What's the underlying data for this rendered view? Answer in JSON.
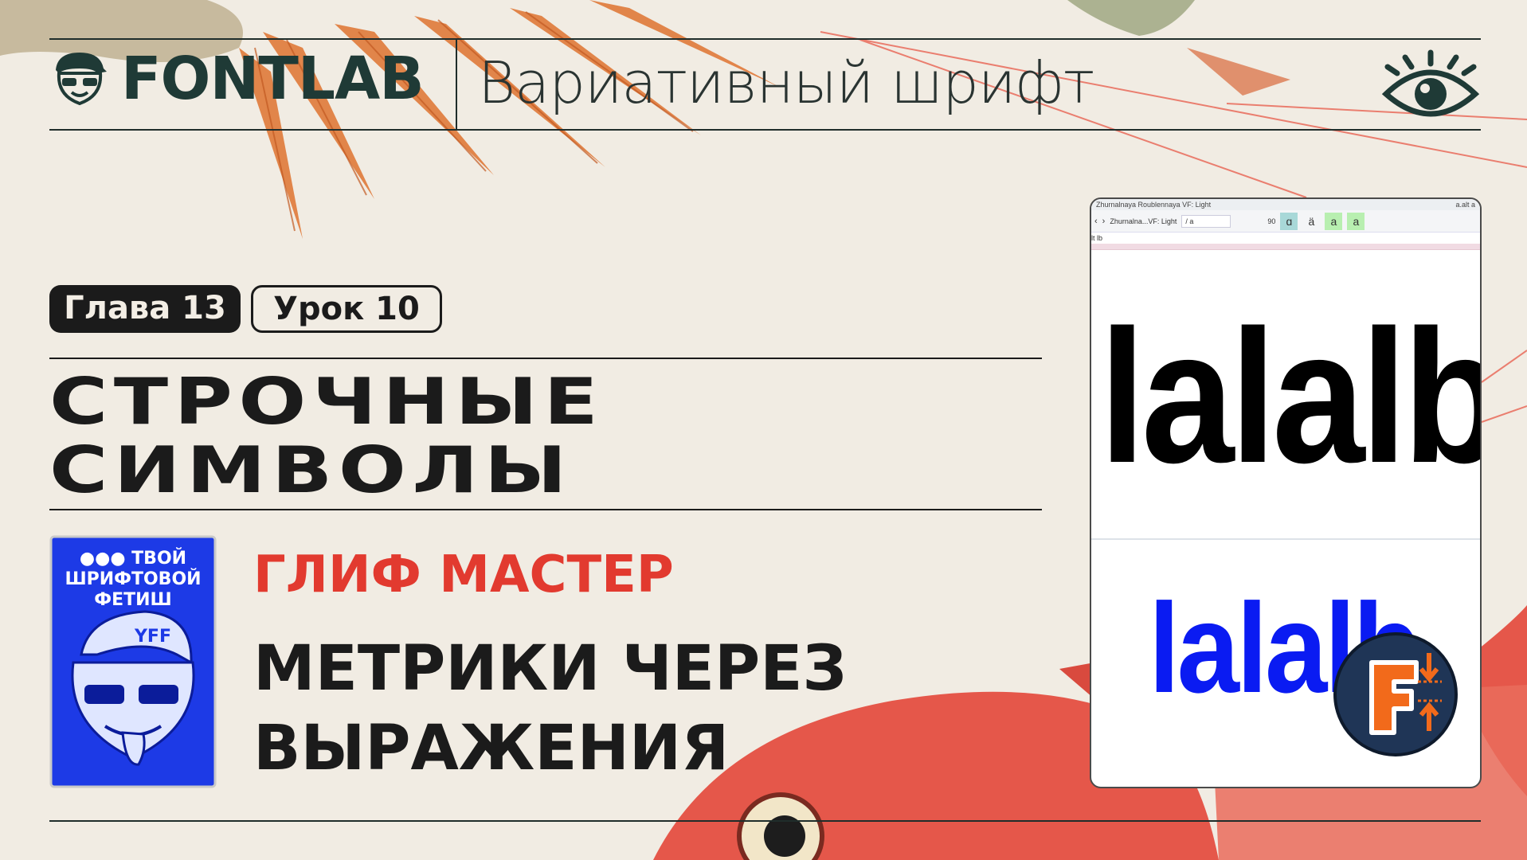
{
  "header": {
    "brand": "FONTLAB",
    "series_title": "Вариативный шрифт"
  },
  "badges": {
    "chapter": "Глава 13",
    "lesson": "Урок 10"
  },
  "section": {
    "line1": "СТРОЧНЫЕ",
    "line2": "СИМВОЛЫ"
  },
  "sticker": {
    "line1": "●●● ТВОЙ",
    "line2": "ШРИФТОВОЙ",
    "line3": "ФЕТИШ",
    "cap_text": "YFF"
  },
  "course": {
    "name": "ГЛИФ МАСТЕР",
    "lesson_line1": "МЕТРИКИ ЧЕРЕЗ",
    "lesson_line2": "ВЫРАЖЕНИЯ"
  },
  "app_window": {
    "title_left": "Zhurnalnaya Roublennaya VF: Light",
    "title_right": "a.alt a",
    "toolbar_font": "Zhurnalna...VF: Light",
    "toolbar_field": "/ a",
    "toolbar_value": "90",
    "glyphs": [
      "ɑ",
      "ä",
      "a",
      "a"
    ],
    "text_line": "lt lb",
    "preview_text": "lalalb",
    "preview_blue_text": "lalalb"
  },
  "colors": {
    "background": "#f1ece3",
    "accent_red": "#e23a2f",
    "ink": "#1b1b1b",
    "brand_dark": "#1f3a36",
    "preview_blue": "#0a1bf2",
    "sticker_blue": "#1d3ae6"
  },
  "icons": {
    "eye": "eye-icon",
    "mascot": "mascot-logo-icon",
    "app": "fontlab-app-icon"
  }
}
